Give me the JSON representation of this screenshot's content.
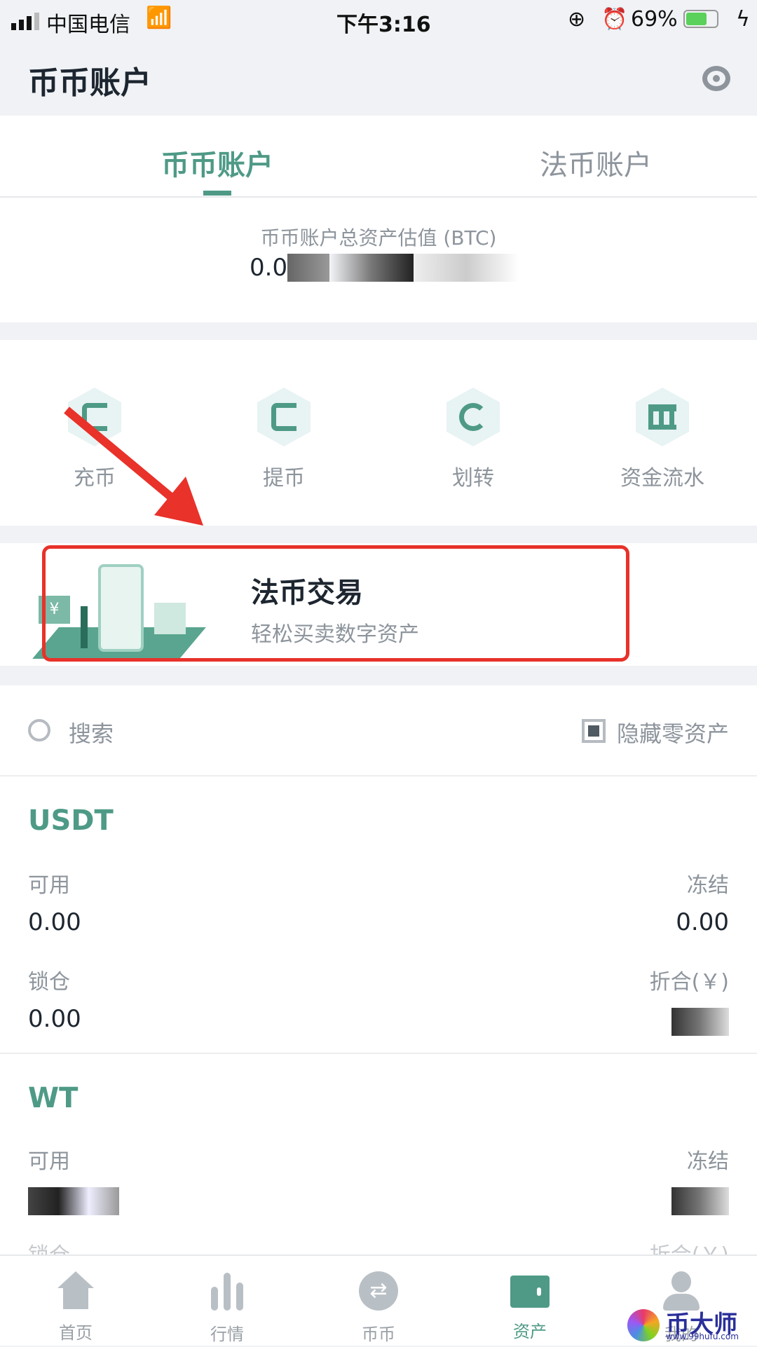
{
  "status_bar": {
    "carrier": "中国电信",
    "time": "下午3:16",
    "battery": "69%",
    "battery_level": 0.69
  },
  "header": {
    "title": "币币账户",
    "eye_icon": "eye-icon"
  },
  "tabs": [
    {
      "label": "币币账户",
      "active": true
    },
    {
      "label": "法币账户",
      "active": false
    }
  ],
  "summary": {
    "label": "币币账户总资产估值 (BTC)",
    "value_visible": "0.0"
  },
  "actions": [
    {
      "label": "充币",
      "icon": "deposit-icon"
    },
    {
      "label": "提币",
      "icon": "withdraw-icon"
    },
    {
      "label": "划转",
      "icon": "transfer-icon"
    },
    {
      "label": "资金流水",
      "icon": "bank-icon"
    }
  ],
  "banner": {
    "title": "法币交易",
    "subtitle": "轻松买卖数字资产"
  },
  "search": {
    "placeholder": "搜索",
    "hide_zero_label": "隐藏零资产",
    "hide_zero_checked": true
  },
  "assets": [
    {
      "name": "USDT",
      "available_label": "可用",
      "available": "0.00",
      "frozen_label": "冻结",
      "frozen": "0.00",
      "locked_label": "锁仓",
      "locked": "0.00",
      "cny_label": "折合(￥)"
    },
    {
      "name": "WT",
      "available_label": "可用",
      "frozen_label": "冻结",
      "locked_label": "锁仓",
      "cny_label": "折合(￥)"
    }
  ],
  "bottom_nav": [
    {
      "label": "首页",
      "icon": "home-icon"
    },
    {
      "label": "行情",
      "icon": "chart-icon"
    },
    {
      "label": "币币",
      "icon": "exchange-icon"
    },
    {
      "label": "资产",
      "icon": "wallet-icon",
      "active": true
    },
    {
      "label": "我的",
      "icon": "user-icon"
    }
  ],
  "colors": {
    "accent": "#4e9a86",
    "annotation": "#e8322a"
  },
  "watermark": {
    "text": "币大师",
    "url": "www.99hufu.com"
  }
}
